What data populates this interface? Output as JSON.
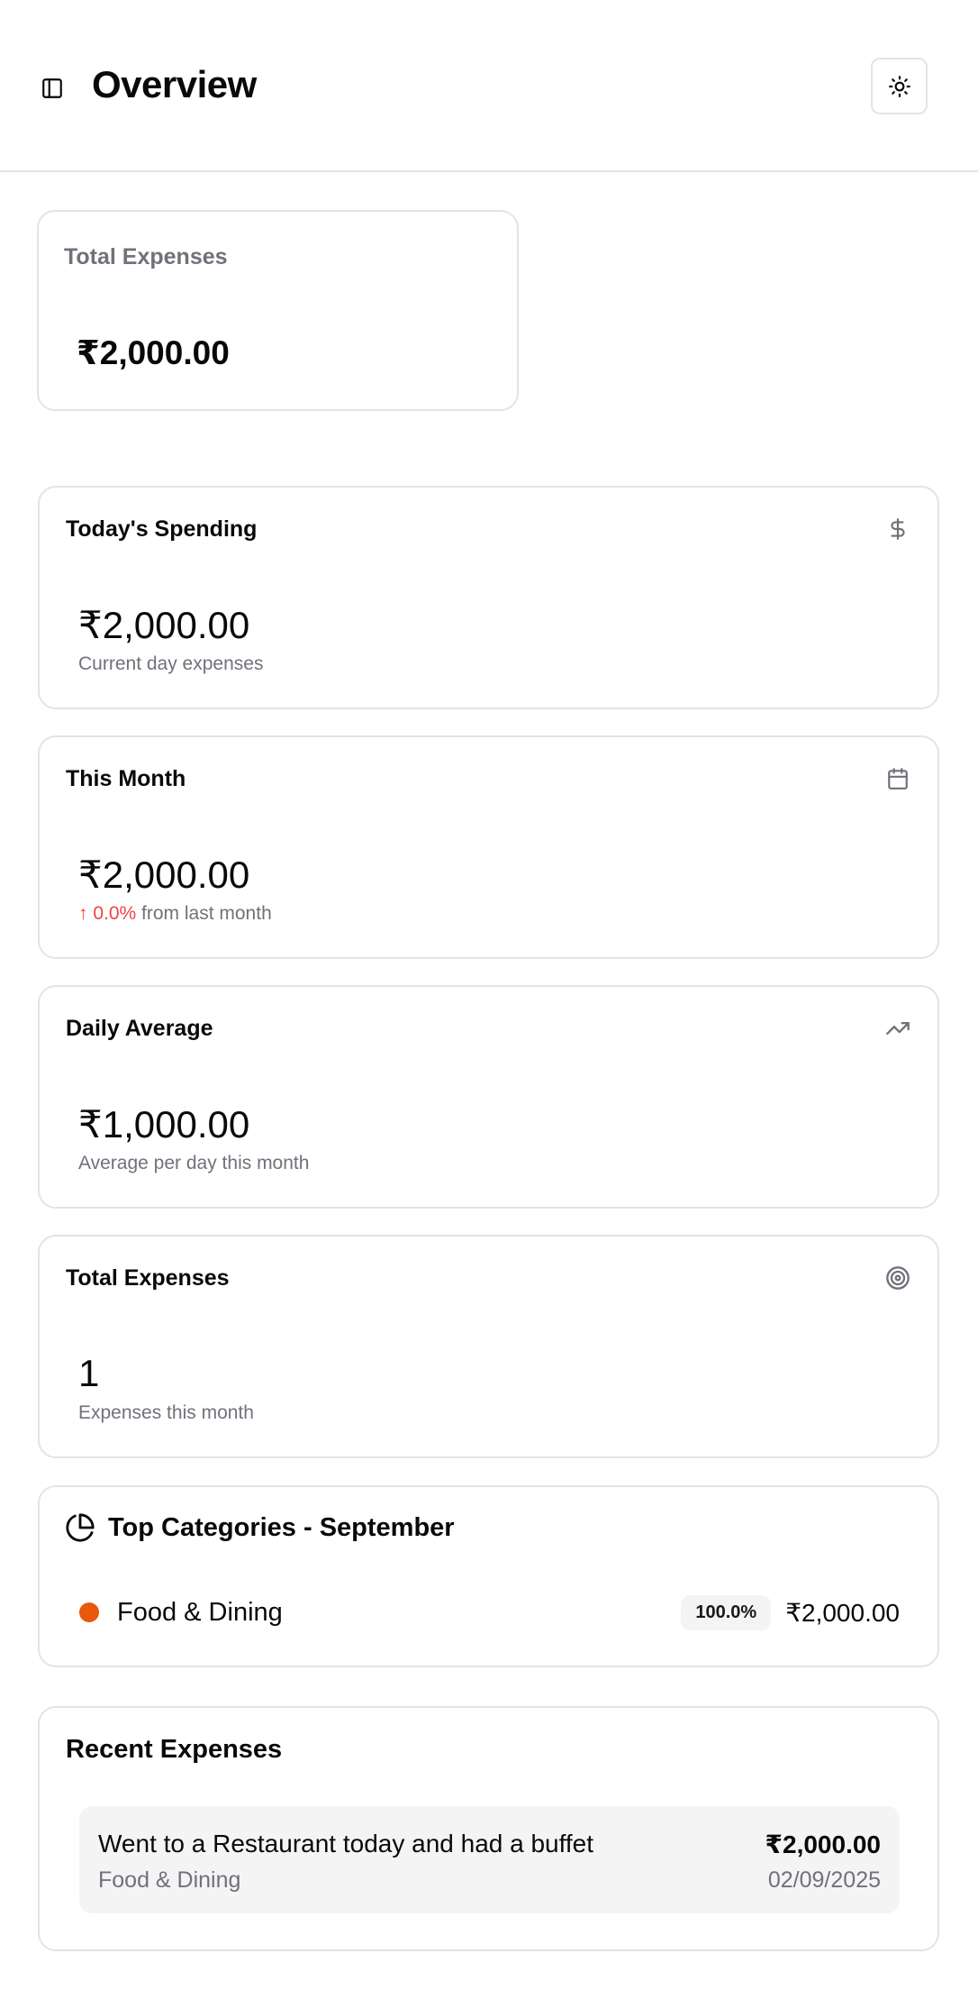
{
  "header": {
    "title": "Overview",
    "sidebar_toggle_icon": "sidebar-icon",
    "theme_icon": "sun-icon"
  },
  "total_summary": {
    "label": "Total Expenses",
    "value": "₹2,000.00"
  },
  "stats": [
    {
      "title": "Today's Spending",
      "icon": "dollar-icon",
      "value": "₹2,000.00",
      "sub": "Current day expenses"
    },
    {
      "title": "This Month",
      "icon": "calendar-icon",
      "value": "₹2,000.00",
      "change": "↑ 0.0%",
      "sub": " from last month"
    },
    {
      "title": "Daily Average",
      "icon": "trending-up-icon",
      "value": "₹1,000.00",
      "sub": "Average per day this month"
    },
    {
      "title": "Total Expenses",
      "icon": "target-icon",
      "value": "1",
      "sub": "Expenses this month"
    }
  ],
  "top_categories": {
    "title": "Top Categories - September",
    "items": [
      {
        "name": "Food & Dining",
        "percent": "100.0%",
        "amount": "₹2,000.00",
        "color": "#ea580c"
      }
    ]
  },
  "recent_expenses": {
    "title": "Recent Expenses",
    "items": [
      {
        "description": "Went to a Restaurant today and had a buffet",
        "category": "Food & Dining",
        "amount": "₹2,000.00",
        "date": "02/09/2025"
      }
    ]
  },
  "colors": {
    "border": "#e4e4e7",
    "muted_text": "#71717a",
    "negative": "#ef4444",
    "accent_category": "#ea580c"
  }
}
